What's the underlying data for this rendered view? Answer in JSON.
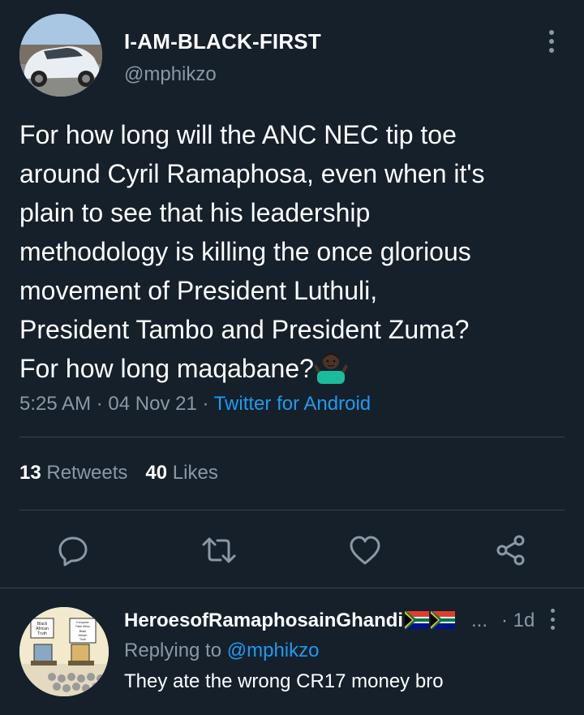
{
  "tweet": {
    "author_name": "I-AM-BLACK-FIRST",
    "author_handle": "@mphikzo",
    "text": "For how long will the ANC NEC tip toe\naround Cyril Ramaphosa, even when it's\nplain to see that his leadership\nmethodology is killing the once glorious\nmovement of President Luthuli,\nPresident Tambo and President Zuma?\nFor how long maqabane?",
    "emoji": "person-shrugging-emoji",
    "time": "5:25 AM",
    "date": "04 Nov 21",
    "separator": "·",
    "source": "Twitter for Android",
    "retweets_count": "13",
    "retweets_label": "Retweets",
    "likes_count": "40",
    "likes_label": "Likes"
  },
  "actions": [
    {
      "name": "reply-icon"
    },
    {
      "name": "retweet-icon"
    },
    {
      "name": "like-icon"
    },
    {
      "name": "share-icon"
    }
  ],
  "reply": {
    "author_name": "HeroesofRamaphosainGhandi",
    "ellipsis": "...",
    "time": "· 1d",
    "replying_prefix": "Replying to",
    "replying_handle": "@mphikzo",
    "text": "They ate the wrong CR17 money bro",
    "avatar_sign_left": "Black African Truth",
    "avatar_sign_right": "European Fake News Black African Truth"
  },
  "colors": {
    "background": "#15202b",
    "text": "#ffffff",
    "muted": "#8b98a5",
    "accent": "#1d9bf0",
    "divider": "#38444d"
  }
}
